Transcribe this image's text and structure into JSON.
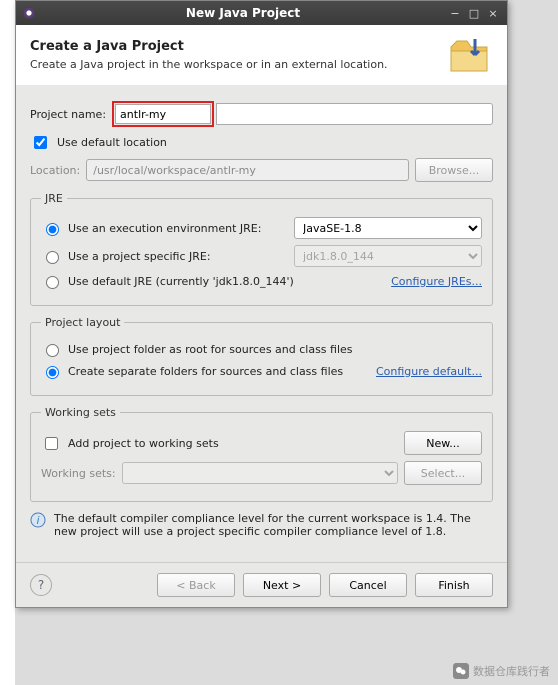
{
  "window": {
    "title": "New Java Project"
  },
  "header": {
    "title": "Create a Java Project",
    "subtitle": "Create a Java project in the workspace or in an external location."
  },
  "project_name": {
    "label": "Project name:",
    "value": "antlr-my"
  },
  "default_location": {
    "checked": true,
    "label": "Use default location"
  },
  "location": {
    "label": "Location:",
    "value": "/usr/local/workspace/antlr-my",
    "browse": "Browse..."
  },
  "jre": {
    "legend": "JRE",
    "opt_env": "Use an execution environment JRE:",
    "env_value": "JavaSE-1.8",
    "opt_specific": "Use a project specific JRE:",
    "specific_value": "jdk1.8.0_144",
    "opt_default": "Use default JRE (currently 'jdk1.8.0_144')",
    "configure": "Configure JREs..."
  },
  "layout": {
    "legend": "Project layout",
    "opt_root": "Use project folder as root for sources and class files",
    "opt_sep": "Create separate folders for sources and class files",
    "configure": "Configure default..."
  },
  "working_sets": {
    "legend": "Working sets",
    "add_label": "Add project to working sets",
    "new": "New...",
    "label": "Working sets:",
    "select": "Select..."
  },
  "info": "The default compiler compliance level for the current workspace is 1.4. The new project will use a project specific compiler compliance level of 1.8.",
  "buttons": {
    "back": "< Back",
    "next": "Next >",
    "cancel": "Cancel",
    "finish": "Finish"
  },
  "watermark": "数据仓库践行者"
}
